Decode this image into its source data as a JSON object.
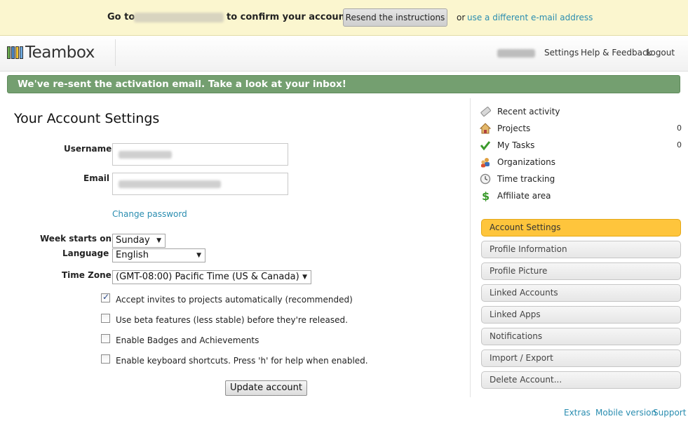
{
  "confirm_bar": {
    "go_to": "Go to",
    "confirm_text": "to confirm your account.",
    "resend_button": "Resend the instructions",
    "or": "or",
    "different_email_link": "use a different e-mail address"
  },
  "header": {
    "logo_text": "Teambox",
    "nav": {
      "settings": "Settings",
      "help": "Help & Feedback",
      "logout": "Logout"
    }
  },
  "flash": "We've re-sent the activation email. Take a look at your inbox!",
  "main": {
    "title": "Your Account Settings",
    "username_label": "Username",
    "email_label": "Email",
    "change_password": "Change password",
    "week_label": "Week starts on",
    "week_value": "Sunday",
    "language_label": "Language",
    "language_value": "English",
    "timezone_label": "Time Zone",
    "timezone_value": "(GMT-08:00) Pacific Time (US & Canada)",
    "checkboxes": [
      {
        "label": "Accept invites to projects automatically (recommended)",
        "checked": true
      },
      {
        "label": "Use beta features (less stable) before they're released.",
        "checked": false
      },
      {
        "label": "Enable Badges and Achievements",
        "checked": false
      },
      {
        "label": "Enable keyboard shortcuts. Press 'h' for help when enabled.",
        "checked": false
      }
    ],
    "update_button": "Update account"
  },
  "sidebar": {
    "nav": [
      {
        "label": "Recent activity",
        "icon": "recent-activity-icon"
      },
      {
        "label": "Projects",
        "icon": "house-icon",
        "count": "0"
      },
      {
        "label": "My Tasks",
        "icon": "checkmark-icon",
        "count": "0"
      },
      {
        "label": "Organizations",
        "icon": "people-icon"
      },
      {
        "label": "Time tracking",
        "icon": "clock-icon"
      },
      {
        "label": "Affiliate area",
        "icon": "dollar-icon"
      }
    ],
    "tabs": [
      "Account Settings",
      "Profile Information",
      "Profile Picture",
      "Linked Accounts",
      "Linked Apps",
      "Notifications",
      "Import / Export",
      "Delete Account..."
    ],
    "active_tab": "Account Settings"
  },
  "footer": {
    "extras": "Extras",
    "mobile": "Mobile version",
    "support": "Support"
  },
  "colors": {
    "flash_bg": "#749f70",
    "active_tab": "#fec53c",
    "link": "#2a8db0",
    "confirm_bar_bg": "#fbf6cf"
  }
}
